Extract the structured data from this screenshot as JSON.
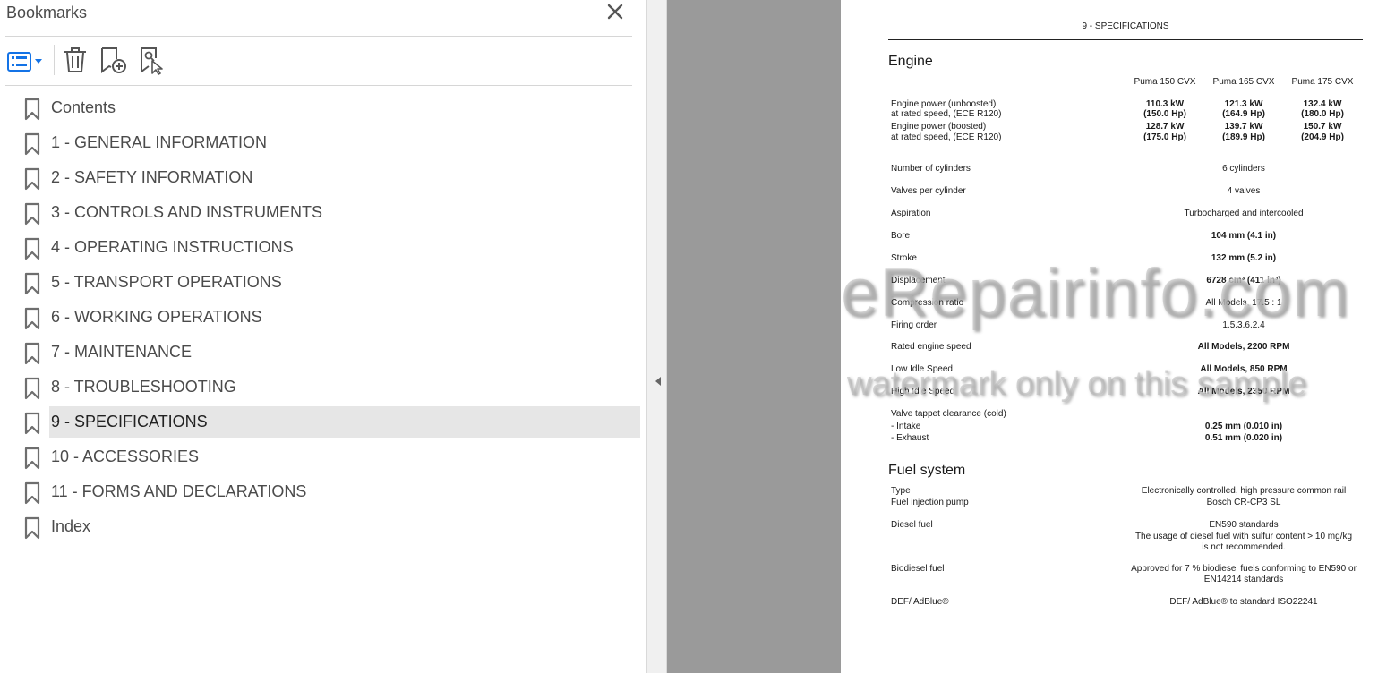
{
  "panel": {
    "title": "Bookmarks",
    "bookmarks": [
      {
        "label": "Contents"
      },
      {
        "label": "1 - GENERAL INFORMATION"
      },
      {
        "label": "2 - SAFETY INFORMATION"
      },
      {
        "label": "3 - CONTROLS AND INSTRUMENTS"
      },
      {
        "label": "4 - OPERATING INSTRUCTIONS"
      },
      {
        "label": "5 - TRANSPORT OPERATIONS"
      },
      {
        "label": "6 - WORKING OPERATIONS"
      },
      {
        "label": "7 - MAINTENANCE"
      },
      {
        "label": "8 - TROUBLESHOOTING"
      },
      {
        "label": "9 - SPECIFICATIONS",
        "selected": true
      },
      {
        "label": "10 - ACCESSORIES"
      },
      {
        "label": "11 - FORMS AND DECLARATIONS"
      },
      {
        "label": "Index"
      }
    ],
    "toolbar_icons": [
      "options-menu-icon",
      "trash-icon",
      "add-bookmark-icon",
      "find-bookmark-icon"
    ],
    "accent_color": "#1473e6"
  },
  "document": {
    "header": "9 - SPECIFICATIONS",
    "engine": {
      "heading": "Engine",
      "models": [
        "Puma 150 CVX",
        "Puma 165 CVX",
        "Puma 175 CVX"
      ],
      "power_unboosted": {
        "label1": "Engine power (unboosted)",
        "label2": "at rated speed, (ECE R120)",
        "kw": [
          "110.3 kW",
          "121.3 kW",
          "132.4 kW"
        ],
        "hp": [
          "(150.0 Hp)",
          "(164.9 Hp)",
          "(180.0 Hp)"
        ]
      },
      "power_boosted": {
        "label1": "Engine power (boosted)",
        "label2": "at rated speed, (ECE R120)",
        "kw": [
          "128.7 kW",
          "139.7 kW",
          "150.7 kW"
        ],
        "hp": [
          "(175.0 Hp)",
          "(189.9 Hp)",
          "(204.9 Hp)"
        ]
      },
      "specs": [
        {
          "label": "Number of cylinders",
          "value": "6 cylinders",
          "bold": false
        },
        {
          "label": "Valves per cylinder",
          "value": "4 valves",
          "bold": false
        },
        {
          "label": "Aspiration",
          "value": "Turbocharged and intercooled",
          "bold": false
        },
        {
          "label": "Bore",
          "value": "104 mm (4.1 in)",
          "bold": true
        },
        {
          "label": "Stroke",
          "value": "132 mm (5.2 in)",
          "bold": true
        },
        {
          "label": "Displacement",
          "value": "6728 cm³ (411 in³)",
          "bold": true
        },
        {
          "label": "Compression ratio",
          "value": "All Models, 17.5 : 1",
          "bold": false
        },
        {
          "label": "Firing order",
          "value": "1.5.3.6.2.4",
          "bold": false
        },
        {
          "label": "Rated engine speed",
          "value": "All Models, 2200 RPM",
          "bold": true
        },
        {
          "label": "Low Idle Speed",
          "value": "All Models, 850 RPM",
          "bold": true
        },
        {
          "label": "High Idle Speed",
          "value": "All Models, 2350 RPM",
          "bold": true
        }
      ],
      "valve_tappet": {
        "label": "Valve tappet clearance (cold)",
        "intake_label": "- Intake",
        "intake_value": "0.25 mm (0.010 in)",
        "exhaust_label": "- Exhaust",
        "exhaust_value": "0.51 mm (0.020 in)"
      }
    },
    "fuel": {
      "heading": "Fuel system",
      "type_label": "Type",
      "type_value": "Electronically controlled, high pressure common rail",
      "pump_label": "Fuel injection pump",
      "pump_value": "Bosch CR-CP3 SL",
      "diesel_label": "Diesel fuel",
      "diesel_value1": "EN590 standards",
      "diesel_value2": "The usage of diesel fuel with sulfur content > 10 mg/kg",
      "diesel_value3": "is not recommended.",
      "biodiesel_label": "Biodiesel fuel",
      "biodiesel_value1": "Approved for 7 % biodiesel fuels conforming to EN590 or",
      "biodiesel_value2": "EN14214 standards",
      "def_label": "DEF/ AdBlue®",
      "def_value": "DEF/ AdBlue® to standard ISO22241"
    }
  },
  "watermark": {
    "line1": "eRepairinfo.com",
    "line2": "watermark only on this sample"
  }
}
